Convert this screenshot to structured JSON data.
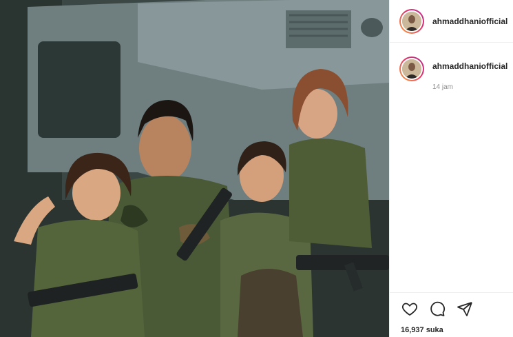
{
  "post": {
    "author": "ahmaddhaniofficial",
    "photo_description_icon": "photo-icon"
  },
  "comment": {
    "author": "ahmaddhaniofficial",
    "time": "14 jam"
  },
  "actions": {
    "like_icon": "heart-icon",
    "comment_icon": "comment-icon",
    "share_icon": "share-icon"
  },
  "likes": {
    "text": "16,937 suka"
  },
  "colors": {
    "story_ring_start": "#f9a23a",
    "story_ring_end": "#b1308f",
    "muted_text": "#8e8e8e",
    "divider": "#efefef"
  }
}
